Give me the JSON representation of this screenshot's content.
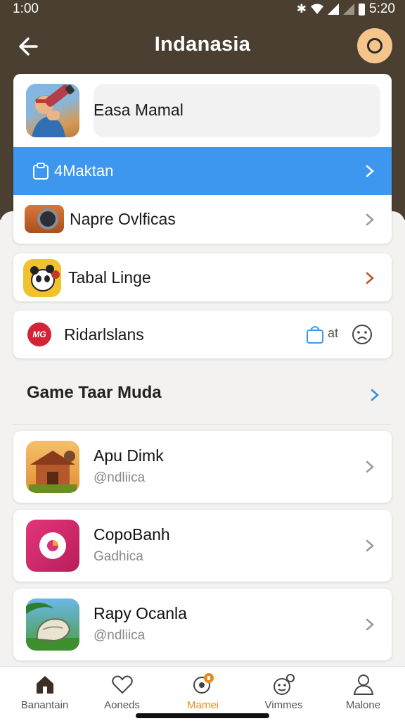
{
  "status_bar": {
    "time_left": "1:00",
    "time_right": "5:20"
  },
  "app_bar": {
    "title": "Indanasia"
  },
  "search": {
    "value": "Easa Mamal"
  },
  "menu": {
    "highlighted_label": "4Maktan",
    "camera_row_label": "Napre Ovlficas",
    "tabal_row_label": "Tabal Linge",
    "ridar_row_label": "Ridarlslans",
    "ridar_badge_text": "at",
    "ridar_logo_text": "MG"
  },
  "section": {
    "title": "Game Taar Muda"
  },
  "games": [
    {
      "name": "Apu Dimk",
      "subtitle": "@ndliica"
    },
    {
      "name": "CopoBanh",
      "subtitle": "Gadhica"
    },
    {
      "name": "Rapy Ocanla",
      "subtitle": "@ndliica"
    }
  ],
  "bottom_nav": [
    {
      "label": "Banantain",
      "icon": "home-icon",
      "active": false
    },
    {
      "label": "Aoneds",
      "icon": "heart-icon",
      "active": false
    },
    {
      "label": "Mamei",
      "icon": "games-icon",
      "active": true
    },
    {
      "label": "Vimmes",
      "icon": "controller-icon",
      "active": false
    },
    {
      "label": "Malone",
      "icon": "person-icon",
      "active": false
    }
  ],
  "colors": {
    "header_bg": "#4a3f31",
    "accent_blue": "#3e97ef",
    "accent_orange": "#e98a1d",
    "profile_bg": "#f6c58c"
  }
}
